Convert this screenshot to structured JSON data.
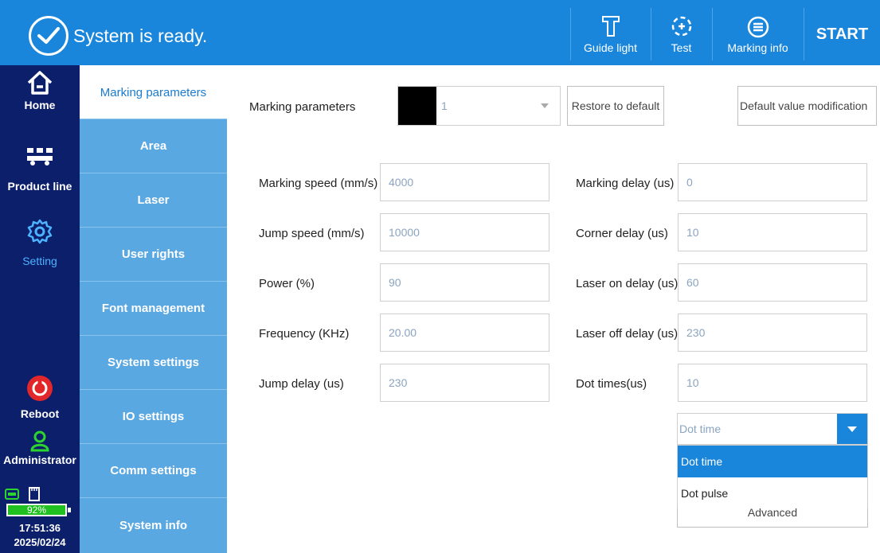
{
  "header": {
    "status_text": "System is ready.",
    "buttons": [
      {
        "label": "Guide light",
        "icon": "guide-light-icon"
      },
      {
        "label": "Test",
        "icon": "test-icon"
      },
      {
        "label": "Marking info",
        "icon": "marking-info-icon"
      }
    ],
    "start_label": "START"
  },
  "nav": {
    "items": [
      {
        "label": "Home",
        "icon": "home-icon"
      },
      {
        "label": "Product line",
        "icon": "product-line-icon"
      },
      {
        "label": "Setting",
        "icon": "gear-icon"
      }
    ],
    "reboot_label": "Reboot",
    "user_label": "Administrator",
    "battery": "92%",
    "time": "17:51:36",
    "date": "2025/02/24"
  },
  "submenu": {
    "items": [
      "Marking parameters",
      "Area",
      "Laser",
      "User rights",
      "Font management",
      "System settings",
      "IO settings",
      "Comm settings",
      "System info"
    ]
  },
  "params": {
    "label": "Marking parameters",
    "selected": "1",
    "restore_label": "Restore to default",
    "default_mod_label": "Default value modification"
  },
  "left_fields": [
    {
      "label": "Marking speed (mm/s)",
      "value": "4000"
    },
    {
      "label": "Jump speed (mm/s)",
      "value": "10000"
    },
    {
      "label": "Power (%)",
      "value": "90"
    },
    {
      "label": "Frequency (KHz)",
      "value": "20.00"
    },
    {
      "label": "Jump delay (us)",
      "value": "230"
    }
  ],
  "right_fields": [
    {
      "label": "Marking delay (us)",
      "value": "0"
    },
    {
      "label": "Corner delay (us)",
      "value": "10"
    },
    {
      "label": "Laser on delay (us)",
      "value": "60"
    },
    {
      "label": "Laser off delay (us)",
      "value": "230"
    },
    {
      "label": "Dot times(us)",
      "value": "10"
    }
  ],
  "dot_mode": {
    "value": "Dot time",
    "options": [
      "Dot time",
      "Dot pulse"
    ]
  },
  "advanced_label": "Advanced",
  "colors": {
    "header_blue": "#1a86db",
    "nav_dark": "#0b1f6b",
    "submenu_blue": "#5aa8e2",
    "active_text": "#4db3ff"
  }
}
